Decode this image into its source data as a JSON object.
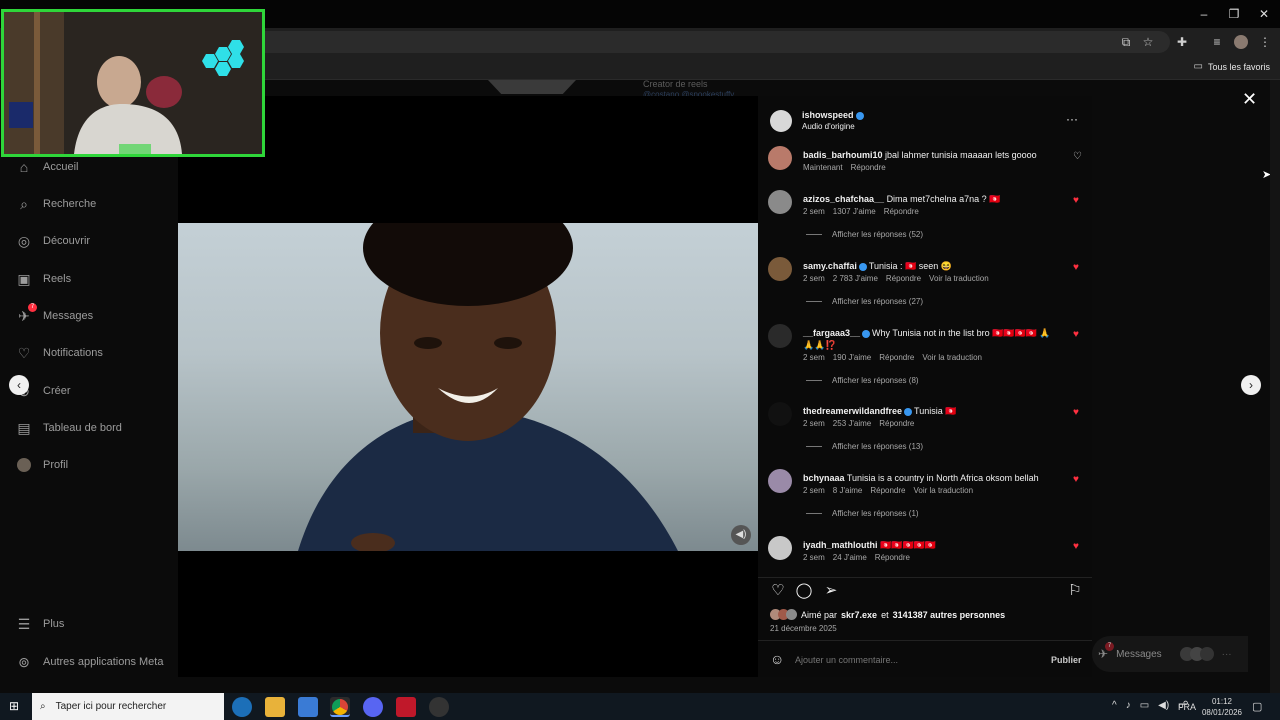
{
  "browser": {
    "favorites_label": "Tous les favoris",
    "faded_text_1": "Creator de reels",
    "faded_text_2": "@costano @snookestuffy"
  },
  "sidebar": {
    "items": [
      {
        "label": "Accueil",
        "icon": "home-icon"
      },
      {
        "label": "Recherche",
        "icon": "search-icon"
      },
      {
        "label": "Découvrir",
        "icon": "compass-icon"
      },
      {
        "label": "Reels",
        "icon": "reels-icon"
      },
      {
        "label": "Messages",
        "icon": "messenger-icon",
        "badge": "7"
      },
      {
        "label": "Notifications",
        "icon": "heart-icon"
      },
      {
        "label": "Créer",
        "icon": "plus-icon"
      },
      {
        "label": "Tableau de bord",
        "icon": "dashboard-icon"
      },
      {
        "label": "Profil",
        "icon": "avatar"
      }
    ],
    "bottom": [
      {
        "label": "Plus",
        "icon": "menu-icon"
      },
      {
        "label": "Autres applications Meta",
        "icon": "meta-icon"
      }
    ]
  },
  "post": {
    "username": "ishowspeed",
    "audio": "Audio d'origine",
    "likes_prefix": "Aimé par",
    "liked_by": "skr7.exe",
    "likes_mid": "et",
    "likes_count": "3141387 autres personnes",
    "date": "21 décembre 2025",
    "comment_placeholder": "Ajouter un commentaire...",
    "publish": "Publier"
  },
  "comments": [
    {
      "user": "badis_barhoumi10",
      "text": "jbal lahmer tunisia maaaan lets goooo",
      "time": "Maintenant",
      "likes": "",
      "reply": "Répondre",
      "translate": "",
      "liked": false,
      "verified": false,
      "replies": "",
      "avatar_color": "#b97a6a"
    },
    {
      "user": "azizos_chafchaa__",
      "text": "Dima met7chelna a7na ? 🇹🇳",
      "time": "2 sem",
      "likes": "1307 J'aime",
      "reply": "Répondre",
      "translate": "",
      "liked": true,
      "verified": false,
      "replies": "Afficher les réponses (52)",
      "avatar_color": "#8a8a8a"
    },
    {
      "user": "samy.chaffai",
      "text": "Tunisia : 🇹🇳 seen 😆",
      "time": "2 sem",
      "likes": "2 783 J'aime",
      "reply": "Répondre",
      "translate": "Voir la traduction",
      "liked": true,
      "verified": true,
      "replies": "Afficher les réponses (27)",
      "avatar_color": "#7a5a3a"
    },
    {
      "user": "__fargaaa3__",
      "text": "Why Tunisia not in the list bro 🇹🇳🇹🇳🇹🇳🇹🇳 🙏🙏🙏⁉️",
      "time": "2 sem",
      "likes": "190 J'aime",
      "reply": "Répondre",
      "translate": "Voir la traduction",
      "liked": true,
      "verified": true,
      "replies": "Afficher les réponses (8)",
      "avatar_color": "#2a2a2a"
    },
    {
      "user": "thedreamerwildandfree",
      "text": "Tunisia 🇹🇳",
      "time": "2 sem",
      "likes": "253 J'aime",
      "reply": "Répondre",
      "translate": "",
      "liked": true,
      "verified": true,
      "replies": "Afficher les réponses (13)",
      "avatar_color": "#111"
    },
    {
      "user": "bchynaaa",
      "text": "Tunisia is a country in North Africa oksom bellah",
      "time": "2 sem",
      "likes": "8 J'aime",
      "reply": "Répondre",
      "translate": "Voir la traduction",
      "liked": true,
      "verified": false,
      "replies": "Afficher les réponses (1)",
      "avatar_color": "#9a8aa8"
    },
    {
      "user": "iyadh_mathlouthi",
      "text": "🇹🇳🇹🇳🇹🇳🇹🇳🇹🇳",
      "time": "2 sem",
      "likes": "24 J'aime",
      "reply": "Répondre",
      "translate": "",
      "liked": true,
      "verified": false,
      "replies": "",
      "avatar_color": "#c8c8c8"
    }
  ],
  "floating_messages": {
    "label": "Messages",
    "badge": "7"
  },
  "taskbar": {
    "search_placeholder": "Taper ici pour rechercher",
    "lang": "FRA",
    "time": "01:12",
    "date": "08/01/2026"
  },
  "colors": {
    "accent_like": "#ff3040",
    "verified": "#3897f0",
    "webcam_border": "#2fd63a"
  }
}
